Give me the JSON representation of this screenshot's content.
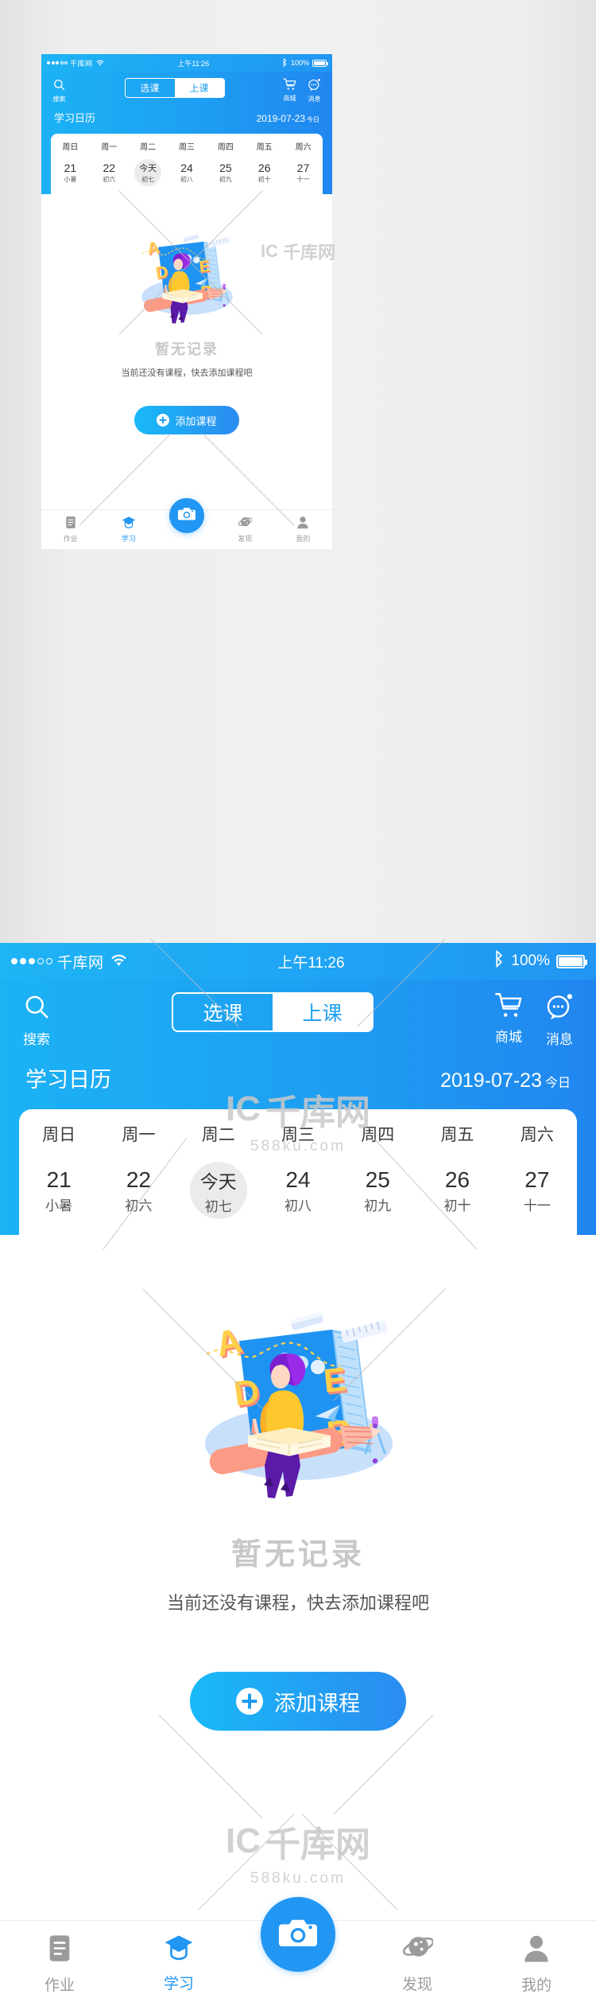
{
  "status_bar": {
    "carrier": "千库网",
    "signal_dots_filled": 3,
    "signal_dots_total": 5,
    "wifi_icon": "wifi-icon",
    "time": "上午11:26",
    "bluetooth_icon": "bluetooth-icon",
    "battery_percent": "100%"
  },
  "header": {
    "search_label": "搜索",
    "search_icon": "search-icon",
    "segment": {
      "options": [
        "选课",
        "上课"
      ],
      "selected": "上课"
    },
    "shop_label": "商城",
    "shop_icon": "shopping-cart-icon",
    "message_label": "消息",
    "message_icon": "message-bubble-icon",
    "calendar_title": "学习日历",
    "calendar_date": "2019-07-23",
    "calendar_today_tag": "今日",
    "accent_color": "#1e9ef2",
    "header_gradient_start": "#1cb2f4",
    "header_gradient_end": "#2086ef"
  },
  "calendar": {
    "weekdays": [
      "周日",
      "周一",
      "周二",
      "周三",
      "周四",
      "周五",
      "周六"
    ],
    "days": [
      {
        "num": "21",
        "lunar": "小暑",
        "selected": false
      },
      {
        "num": "22",
        "lunar": "初六",
        "selected": false
      },
      {
        "num": "今天",
        "lunar": "初七",
        "selected": true
      },
      {
        "num": "24",
        "lunar": "初八",
        "selected": false
      },
      {
        "num": "25",
        "lunar": "初九",
        "selected": false
      },
      {
        "num": "26",
        "lunar": "初十",
        "selected": false
      },
      {
        "num": "27",
        "lunar": "十一",
        "selected": false
      }
    ],
    "selected_bg": "#ebebeb"
  },
  "empty_state": {
    "illustration": "student-reading-on-pencil-illustration",
    "letters": [
      "A",
      "D",
      "E",
      "B"
    ],
    "title": "暂无记录",
    "subtitle": "当前还没有课程，快去添加课程吧",
    "title_color": "#c8c8c8"
  },
  "add_button": {
    "label": "添加课程",
    "icon": "plus-circle-icon",
    "gradient_start": "#19b9f8",
    "gradient_end": "#2b8cf0"
  },
  "tab_bar": {
    "items": [
      {
        "label": "作业",
        "icon": "homework-document-icon",
        "active": false
      },
      {
        "label": "学习",
        "icon": "graduation-cap-icon",
        "active": true
      },
      {
        "label": "发现",
        "icon": "planet-discover-icon",
        "active": false
      },
      {
        "label": "我的",
        "icon": "person-profile-icon",
        "active": false
      }
    ],
    "fab_icon": "camera-icon",
    "active_color": "#2196f3",
    "inactive_color": "#9b9b9b"
  },
  "watermark": {
    "main": "千库网",
    "sub": "588ku.com"
  }
}
